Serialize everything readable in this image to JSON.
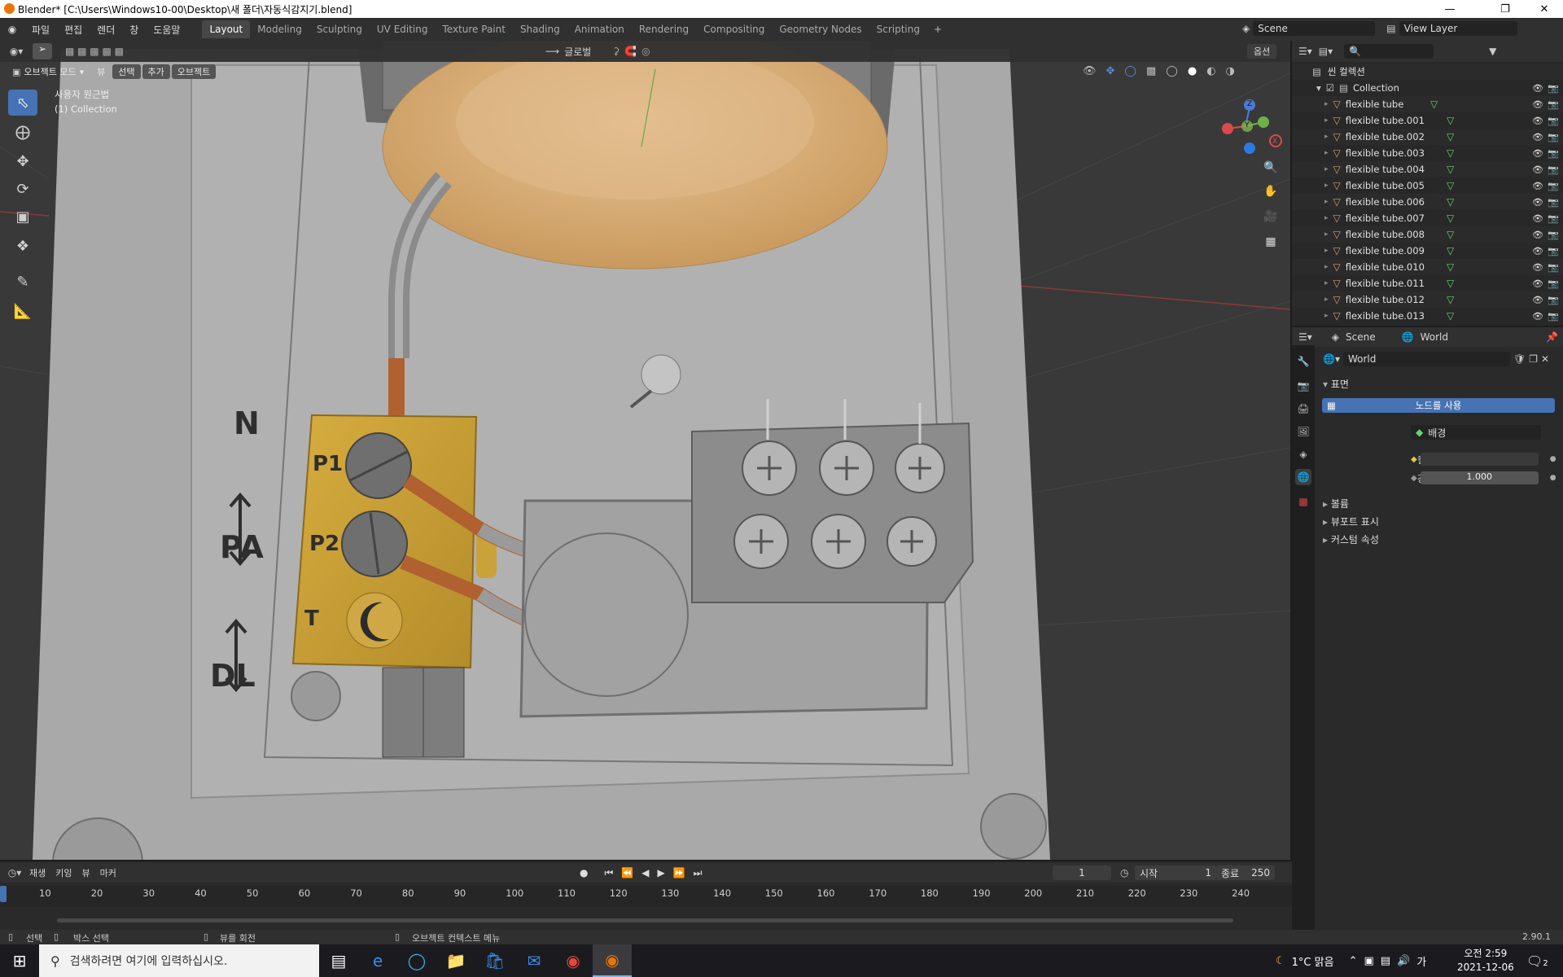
{
  "window": {
    "title": "Blender* [C:\\Users\\Windows10-00\\Desktop\\새 폴더\\자동식감지기.blend]"
  },
  "menus": [
    "파일",
    "편집",
    "렌더",
    "창",
    "도움말"
  ],
  "workspaces": [
    "Layout",
    "Modeling",
    "Sculpting",
    "UV Editing",
    "Texture Paint",
    "Shading",
    "Animation",
    "Rendering",
    "Compositing",
    "Geometry Nodes",
    "Scripting"
  ],
  "active_workspace": "Layout",
  "scene": {
    "name": "Scene",
    "view_layer": "View Layer"
  },
  "viewport": {
    "mode": "오브젝트 모드",
    "header_menus": [
      "뷰",
      "선택",
      "추가",
      "오브젝트"
    ],
    "transform_orientation": "글로벌",
    "options_label": "옵션",
    "overlay_text_1": "사용자 원근법",
    "overlay_text_2": "(1) Collection",
    "model_labels": {
      "n": "N",
      "pa": "PA",
      "dl": "DL",
      "p1": "P1",
      "p2": "P2",
      "t": "T"
    },
    "gizmo": {
      "z": "Z",
      "y": "Y",
      "x": "X"
    }
  },
  "outliner": {
    "root": "씬 컬렉션",
    "collection": "Collection",
    "items": [
      "flexible tube",
      "flexible tube.001",
      "flexible tube.002",
      "flexible tube.003",
      "flexible tube.004",
      "flexible tube.005",
      "flexible tube.006",
      "flexible tube.007",
      "flexible tube.008",
      "flexible tube.009",
      "flexible tube.010",
      "flexible tube.011",
      "flexible tube.012",
      "flexible tube.013"
    ]
  },
  "properties": {
    "breadcrumb_scene": "Scene",
    "breadcrumb_world": "World",
    "world_name": "World",
    "surface_panel": "표면",
    "use_nodes_button": "노드를 사용",
    "surface_label": "표면",
    "surface_value": "배경",
    "color_label": "컬러",
    "strength_label": "강도",
    "strength_value": "1.000",
    "volume_panel": "볼륨",
    "viewport_display_panel": "뷰포트 표시",
    "custom_props_panel": "커스텀 속성"
  },
  "timeline": {
    "menus": [
      "재생",
      "키잉",
      "뷰",
      "마커"
    ],
    "current_frame": "1",
    "start_label": "시작",
    "start_value": "1",
    "end_label": "종료",
    "end_value": "250",
    "ticks": [
      "10",
      "20",
      "30",
      "40",
      "50",
      "60",
      "70",
      "80",
      "90",
      "100",
      "110",
      "120",
      "130",
      "140",
      "150",
      "160",
      "170",
      "180",
      "190",
      "200",
      "210",
      "220",
      "230",
      "240"
    ]
  },
  "statusbar": {
    "select": "선택",
    "box_select": "박스 선택",
    "rotate_view": "뷰를 회전",
    "context_menu": "오브젝트 컨텍스트 메뉴",
    "version": "2.90.1"
  },
  "taskbar": {
    "search_placeholder": "검색하려면 여기에 입력하십시오.",
    "weather": "1°C 맑음",
    "ime": "가",
    "time": "오전 2:59",
    "date": "2021-12-06",
    "notifications": "2"
  },
  "colors": {
    "accent": "#4772b3",
    "brass": "#c9a23a",
    "copper": "#b0612f",
    "viewport_bg": "#393939"
  }
}
